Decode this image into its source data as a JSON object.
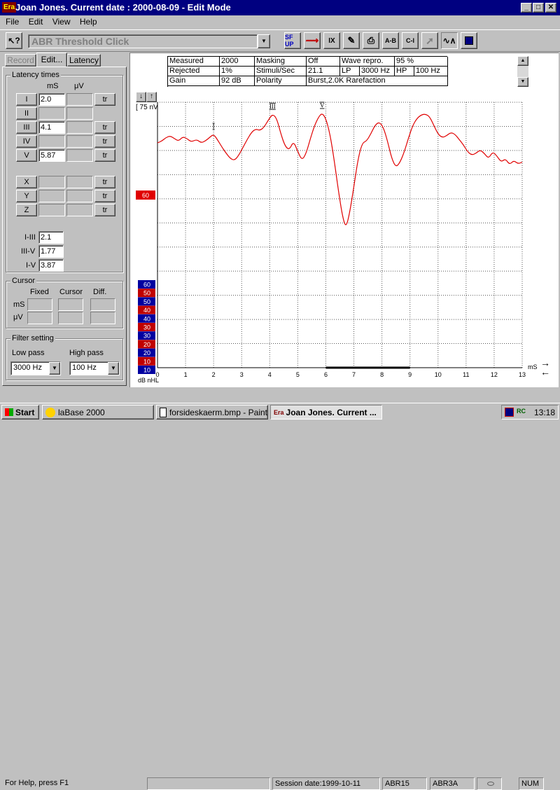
{
  "window": {
    "title": "Joan Jones. Current date : 2000-08-09 - Edit Mode",
    "app_badge": "Era",
    "controls": [
      "_",
      "□",
      "✕"
    ]
  },
  "menu": [
    "File",
    "Edit",
    "View",
    "Help"
  ],
  "toolbar": {
    "protocol": "ABR Threshold Click",
    "buttons": [
      "SF UP",
      "curve-add",
      "IX",
      "edit",
      "print",
      "A-B",
      "C-I",
      "arrow",
      "wave",
      "save"
    ]
  },
  "tabs": [
    "Record",
    "Edit...",
    "Latency"
  ],
  "latency": {
    "group_title": "Latency times",
    "col_ms": "mS",
    "col_uv": "μV",
    "rows": [
      {
        "label": "I",
        "ms": "2.0",
        "uv": "",
        "btn": "tr"
      },
      {
        "label": "II",
        "ms": "",
        "uv": "",
        "btn": ""
      },
      {
        "label": "III",
        "ms": "4.1",
        "uv": "",
        "btn": "tr"
      },
      {
        "label": "IV",
        "ms": "",
        "uv": "",
        "btn": "tr"
      },
      {
        "label": "V",
        "ms": "5.87",
        "uv": "",
        "btn": "tr"
      },
      {
        "label": "X",
        "ms": "",
        "uv": "",
        "btn": "tr"
      },
      {
        "label": "Y",
        "ms": "",
        "uv": "",
        "btn": "tr"
      },
      {
        "label": "Z",
        "ms": "",
        "uv": "",
        "btn": "tr"
      }
    ],
    "intervals": [
      {
        "label": "I-III",
        "value": "2.1"
      },
      {
        "label": "III-V",
        "value": "1.77"
      },
      {
        "label": "I-V",
        "value": "3.87"
      }
    ]
  },
  "cursor": {
    "group_title": "Cursor",
    "cols": [
      "Fixed",
      "Cursor",
      "Diff."
    ],
    "rows": [
      "mS",
      "μV"
    ]
  },
  "filter": {
    "group_title": "Filter setting",
    "low_label": "Low pass",
    "high_label": "High pass",
    "low_value": "3000 Hz",
    "high_value": "100 Hz"
  },
  "info_table": {
    "rows": [
      [
        [
          "Measured",
          "2000"
        ],
        [
          "Masking",
          "Off"
        ],
        [
          "Wave repro.",
          "95 %"
        ]
      ],
      [
        [
          "Rejected",
          "1%"
        ],
        [
          "Stimuli/Sec",
          "21.1"
        ],
        [
          "LP",
          "3000 Hz"
        ],
        [
          "HP",
          "100 Hz"
        ]
      ],
      [
        [
          "Gain",
          "92 dB"
        ],
        [
          "Polarity",
          "Burst,2.0K Rarefaction"
        ]
      ]
    ]
  },
  "chart_data": {
    "type": "line",
    "scale_label": "[ 75 nV",
    "xlabel": "mS",
    "level_unit": "dB nHL",
    "current_level": "60",
    "x_ticks": [
      "0",
      "1",
      "2",
      "3",
      "4",
      "5",
      "6",
      "7",
      "8",
      "9",
      "10",
      "11",
      "12",
      "13"
    ],
    "xlim": [
      0,
      13
    ],
    "peaks": [
      {
        "label": "I",
        "x": 2.0
      },
      {
        "label": "III",
        "x": 4.1
      },
      {
        "label": "V",
        "x": 5.87
      }
    ],
    "levels": [
      {
        "value": "60",
        "color": "#0000a0"
      },
      {
        "value": "50",
        "color": "#c00000"
      },
      {
        "value": "50",
        "color": "#0000a0"
      },
      {
        "value": "40",
        "color": "#c00000"
      },
      {
        "value": "40",
        "color": "#0000a0"
      },
      {
        "value": "30",
        "color": "#c00000"
      },
      {
        "value": "30",
        "color": "#0000a0"
      },
      {
        "value": "20",
        "color": "#c00000"
      },
      {
        "value": "20",
        "color": "#0000a0"
      },
      {
        "value": "10",
        "color": "#c00000"
      },
      {
        "value": "10",
        "color": "#0000a0"
      }
    ],
    "waveform": {
      "color": "#e00000",
      "x": [
        0,
        0.15,
        0.3,
        0.45,
        0.6,
        0.75,
        0.9,
        1.05,
        1.2,
        1.4,
        1.55,
        1.7,
        1.85,
        2.0,
        2.15,
        2.3,
        2.45,
        2.6,
        2.75,
        2.9,
        3.05,
        3.2,
        3.35,
        3.5,
        3.65,
        3.8,
        3.95,
        4.1,
        4.25,
        4.4,
        4.55,
        4.7,
        4.85,
        5.0,
        5.15,
        5.3,
        5.45,
        5.6,
        5.75,
        5.87,
        6.0,
        6.15,
        6.3,
        6.45,
        6.6,
        6.72,
        6.85,
        7.0,
        7.15,
        7.3,
        7.45,
        7.6,
        7.75,
        7.9,
        8.05,
        8.2,
        8.35,
        8.5,
        8.65,
        8.8,
        8.95,
        9.1,
        9.25,
        9.4,
        9.55,
        9.7,
        9.85,
        10.0,
        10.15,
        10.3,
        10.45,
        10.6,
        10.75,
        10.9,
        11.05,
        11.2,
        11.35,
        11.5,
        11.65,
        11.8,
        11.95,
        12.1,
        12.25,
        12.4,
        12.55,
        12.7,
        12.85,
        13.0
      ],
      "y": [
        60,
        62,
        66,
        68,
        65,
        62,
        67,
        65,
        61,
        64,
        60,
        62,
        66,
        70,
        63,
        55,
        48,
        42,
        40,
        46,
        55,
        64,
        72,
        76,
        74,
        78,
        86,
        93,
        88,
        70,
        56,
        52,
        62,
        50,
        40,
        48,
        65,
        80,
        90,
        94,
        88,
        70,
        40,
        5,
        -25,
        -37,
        -20,
        10,
        42,
        60,
        62,
        70,
        80,
        84,
        78,
        62,
        42,
        32,
        38,
        50,
        66,
        80,
        88,
        92,
        93,
        90,
        80,
        70,
        66,
        68,
        72,
        70,
        64,
        58,
        50,
        46,
        48,
        52,
        48,
        42,
        50,
        45,
        38,
        42,
        35,
        40,
        36,
        38
      ]
    }
  },
  "status": {
    "help": "For Help, press F1",
    "session": "Session date:1999-10-11",
    "cells": [
      "ABR15",
      "ABR3A",
      "",
      "NUM"
    ]
  },
  "taskbar": {
    "start": "Start",
    "items": [
      "laBase 2000",
      "forsideskaerm.bmp - Paint",
      "Joan Jones. Current ..."
    ],
    "clock": "13:18"
  }
}
